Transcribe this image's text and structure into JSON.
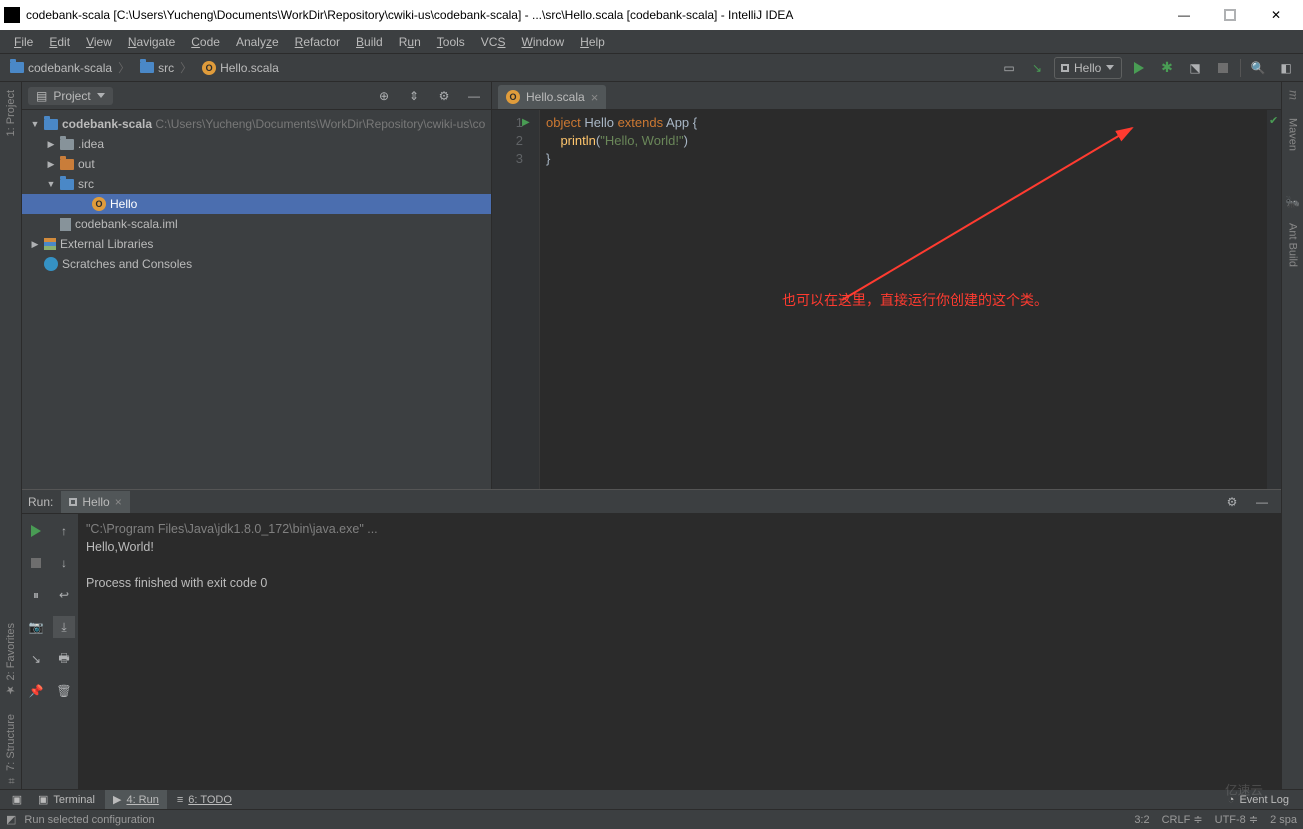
{
  "title": "codebank-scala [C:\\Users\\Yucheng\\Documents\\WorkDir\\Repository\\cwiki-us\\codebank-scala] - ...\\src\\Hello.scala [codebank-scala] - IntelliJ IDEA",
  "menu": [
    "File",
    "Edit",
    "View",
    "Navigate",
    "Code",
    "Analyze",
    "Refactor",
    "Build",
    "Run",
    "Tools",
    "VCS",
    "Window",
    "Help"
  ],
  "breadcrumb": {
    "module": "codebank-scala",
    "folder": "src",
    "file": "Hello.scala"
  },
  "run_config_selected": "Hello",
  "left_gutter": {
    "project": "1: Project",
    "favorites": "2: Favorites",
    "structure": "7: Structure"
  },
  "right_gutter": {
    "maven": "Maven",
    "m": "m",
    "ant": "Ant Build"
  },
  "project": {
    "title": "Project",
    "root": "codebank-scala",
    "root_path": "C:\\Users\\Yucheng\\Documents\\WorkDir\\Repository\\cwiki-us\\co",
    "idea": ".idea",
    "out": "out",
    "src": "src",
    "hello": "Hello",
    "iml": "codebank-scala.iml",
    "extlib": "External Libraries",
    "scratch": "Scratches and Consoles"
  },
  "editor": {
    "tab": "Hello.scala",
    "code_kw1": "object",
    "code_obj": "Hello",
    "code_kw2": "extends",
    "code_app": "App",
    "code_br1": "{",
    "code_fn": "println",
    "code_par1": "(",
    "code_str": "\"Hello, World!\"",
    "code_par2": ")",
    "code_br2": "}",
    "lines": [
      "1",
      "2",
      "3"
    ]
  },
  "annotation": "也可以在这里，直接运行你创建的这个类。",
  "run": {
    "label": "Run:",
    "tab": "Hello",
    "cmd": "\"C:\\Program Files\\Java\\jdk1.8.0_172\\bin\\java.exe\" ...",
    "out1": "Hello,World!",
    "out2": "",
    "out3": "Process finished with exit code 0"
  },
  "bottom_tabs": {
    "terminal": "Terminal",
    "run": "4: Run",
    "todo": "6: TODO",
    "event_log": "Event Log"
  },
  "status": {
    "msg": "Run selected configuration",
    "pos": "3:2",
    "crlf": "CRLF",
    "enc": "UTF-8",
    "indent": "2 spa"
  },
  "watermark": "亿速云"
}
